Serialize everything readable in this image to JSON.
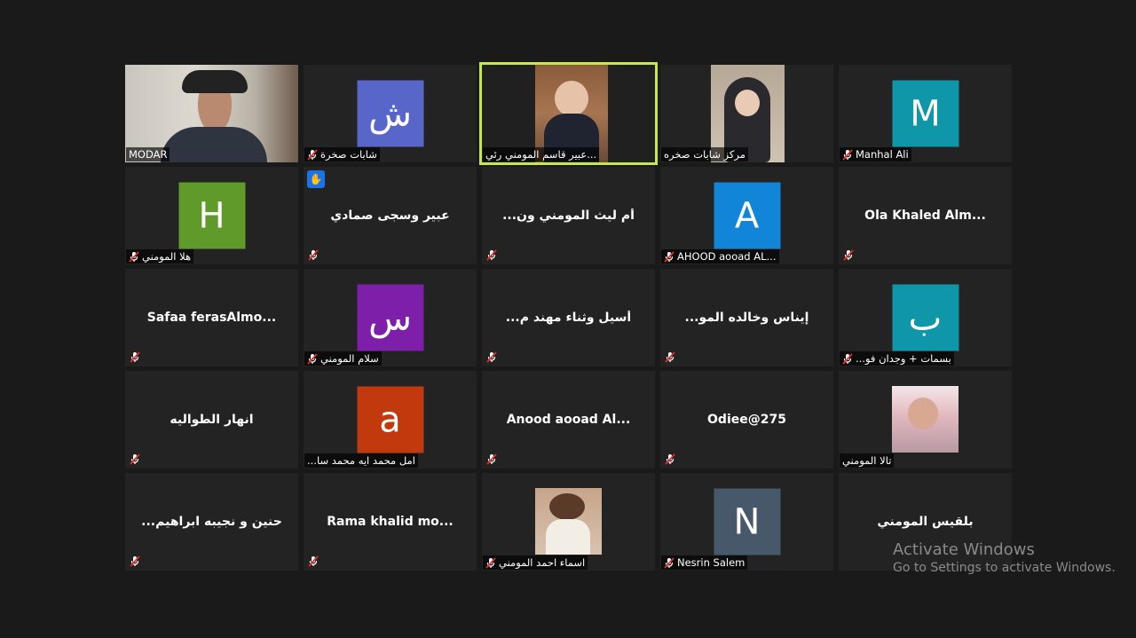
{
  "participants": [
    {
      "id": "p1",
      "label": "MODAR",
      "kind": "video",
      "muted": false
    },
    {
      "id": "p2",
      "label": "شابات صخرة",
      "kind": "avatar",
      "avatar_letter": "ش",
      "avatar_color": "#5865c9",
      "muted": true
    },
    {
      "id": "p3",
      "label": "عبير قاسم المومني رئي...",
      "kind": "video",
      "muted": false,
      "active": true
    },
    {
      "id": "p4",
      "label": "مركز شابات صخره",
      "kind": "video",
      "muted": false
    },
    {
      "id": "p5",
      "label": "Manhal Ali",
      "kind": "avatar",
      "avatar_letter": "M",
      "avatar_color": "#0f96a8",
      "muted": true
    },
    {
      "id": "p6",
      "label": "هلا المومني",
      "kind": "avatar",
      "avatar_letter": "H",
      "avatar_color": "#5f9a2b",
      "muted": true
    },
    {
      "id": "p7",
      "big_name": "عبير وسجى صمادي",
      "kind": "name",
      "muted": true,
      "hand_raised": true
    },
    {
      "id": "p8",
      "big_name": "...أم ليث المومني ون",
      "kind": "name",
      "muted": true
    },
    {
      "id": "p9",
      "label": "AHOOD aooad AL...",
      "kind": "avatar",
      "avatar_letter": "A",
      "avatar_color": "#1185d8",
      "muted": true
    },
    {
      "id": "p10",
      "big_name": "Ola Khaled Alm...",
      "kind": "name",
      "muted": true
    },
    {
      "id": "p11",
      "big_name": "Safaa ferasAlmo...",
      "kind": "name",
      "muted": true
    },
    {
      "id": "p12",
      "label": "سلام المومني",
      "kind": "avatar",
      "avatar_letter": "س",
      "avatar_color": "#7d1fa8",
      "muted": true
    },
    {
      "id": "p13",
      "big_name": "...أسيل وثناء مهند م",
      "kind": "name",
      "muted": true
    },
    {
      "id": "p14",
      "big_name": "...إيناس وخالده المو",
      "kind": "name",
      "muted": true
    },
    {
      "id": "p15",
      "label": "...بسمات + وجدان فو",
      "kind": "avatar",
      "avatar_letter": "ب",
      "avatar_color": "#0f96a8",
      "muted": true
    },
    {
      "id": "p16",
      "big_name": "انهار الطواليه",
      "kind": "name",
      "muted": true
    },
    {
      "id": "p17",
      "label": "...امل محمد ايه محمد سا",
      "kind": "avatar",
      "avatar_letter": "a",
      "avatar_color": "#c1390d",
      "muted": false
    },
    {
      "id": "p18",
      "big_name": "Anood aooad Al...",
      "kind": "name",
      "muted": true
    },
    {
      "id": "p19",
      "big_name": "Odiee@275",
      "kind": "name",
      "muted": true
    },
    {
      "id": "p20",
      "label": "تالا المومني",
      "kind": "photo",
      "muted": false
    },
    {
      "id": "p21",
      "big_name": "...حنين و نجيبه ابراهيم",
      "kind": "name",
      "muted": true
    },
    {
      "id": "p22",
      "big_name": "Rama khalid mo...",
      "kind": "name",
      "muted": true
    },
    {
      "id": "p23",
      "label": "اسماء احمد المومني",
      "kind": "photo",
      "muted": true
    },
    {
      "id": "p24",
      "label": "Nesrin Salem",
      "kind": "avatar",
      "avatar_letter": "N",
      "avatar_color": "#46586a",
      "muted": true
    },
    {
      "id": "p25",
      "big_name": "بلقيس المومني",
      "kind": "name",
      "muted": false
    }
  ],
  "watermark": {
    "title": "Activate Windows",
    "subtitle": "Go to Settings to activate Windows."
  }
}
